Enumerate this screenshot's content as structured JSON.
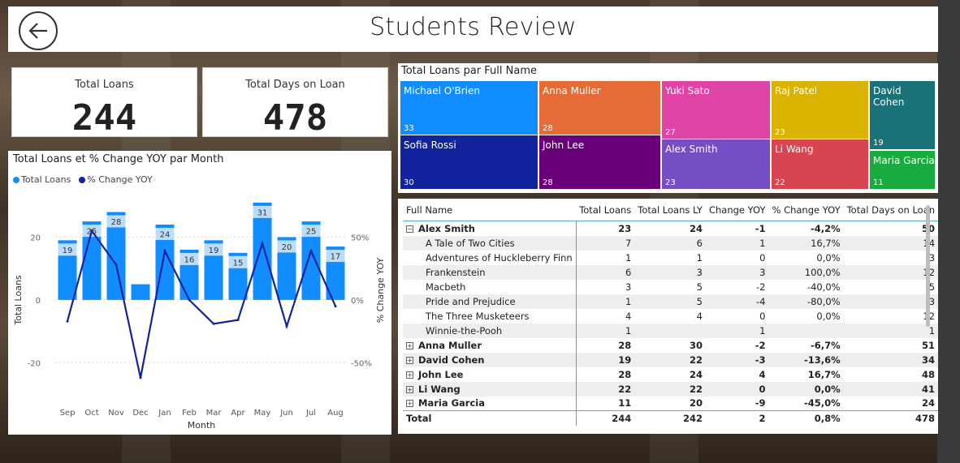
{
  "header": {
    "title": "Students Review"
  },
  "kpis": [
    {
      "label": "Total Loans",
      "value": "244"
    },
    {
      "label": "Total Days on Loan",
      "value": "478"
    }
  ],
  "combo": {
    "title": "Total Loans et % Change YOY par Month",
    "legend": [
      {
        "label": "Total Loans",
        "color": "#118DFF"
      },
      {
        "label": "% Change YOY",
        "color": "#12239E"
      }
    ],
    "xlabel": "Month",
    "ylabel_left": "Total Loans",
    "ylabel_right": "% Change YOY",
    "left_ticks": [
      "20",
      "0",
      "-20"
    ],
    "right_ticks": [
      "50%",
      "0%",
      "-50%"
    ]
  },
  "chart_data": {
    "type": "bar",
    "categories": [
      "Sep",
      "Oct",
      "Nov",
      "Dec",
      "Jan",
      "Feb",
      "Mar",
      "Apr",
      "May",
      "Jun",
      "Jul",
      "Aug"
    ],
    "series": [
      {
        "name": "Total Loans",
        "values": [
          19,
          25,
          28,
          5,
          24,
          16,
          19,
          15,
          31,
          20,
          25,
          17
        ],
        "labels": [
          "19",
          "25",
          "28",
          "",
          "24",
          "16",
          "19",
          "15",
          "31",
          "20",
          "25",
          "17"
        ]
      },
      {
        "name": "% Change YOY",
        "values": [
          -0.17,
          0.55,
          0.28,
          -0.62,
          0.39,
          0.0,
          -0.19,
          -0.16,
          0.45,
          -0.21,
          0.39,
          -0.05
        ]
      }
    ],
    "ylim": [
      -30,
      32
    ],
    "y2lim": [
      -0.75,
      0.8
    ],
    "colors": {
      "bar": "#118DFF",
      "bar_label_bg": "#BCDDF9",
      "line": "#12239E"
    }
  },
  "treemap": {
    "title": "Total Loans par Full Name",
    "tiles": [
      {
        "name": "Michael O'Brien",
        "value": "33",
        "color": "#118DFF"
      },
      {
        "name": "Sofia Rossi",
        "value": "30",
        "color": "#12239E"
      },
      {
        "name": "Anna Muller",
        "value": "28",
        "color": "#E66C37"
      },
      {
        "name": "John Lee",
        "value": "28",
        "color": "#6B007B"
      },
      {
        "name": "Yuki Sato",
        "value": "27",
        "color": "#E044A7"
      },
      {
        "name": "Alex Smith",
        "value": "23",
        "color": "#744EC2"
      },
      {
        "name": "Raj Patel",
        "value": "23",
        "color": "#D9B300"
      },
      {
        "name": "Li Wang",
        "value": "22",
        "color": "#D64550"
      },
      {
        "name": "David Cohen",
        "value": "19",
        "color": "#197278"
      },
      {
        "name": "Maria Garcia",
        "value": "11",
        "color": "#1AAB40"
      }
    ]
  },
  "table": {
    "headers": [
      "Full Name",
      "Total Loans",
      "Total Loans LY",
      "Change YOY",
      "% Change YOY",
      "Total Days on Loan"
    ],
    "rows": [
      {
        "type": "parent",
        "expander": "⊟",
        "cells": [
          "Alex Smith",
          "23",
          "24",
          "-1",
          "-4,2%",
          "50"
        ]
      },
      {
        "type": "child",
        "cells": [
          "A Tale of Two Cities",
          "7",
          "6",
          "1",
          "16,7%",
          "14"
        ]
      },
      {
        "type": "child",
        "cells": [
          "Adventures of Huckleberry Finn",
          "1",
          "1",
          "0",
          "0,0%",
          "3"
        ]
      },
      {
        "type": "child",
        "cells": [
          "Frankenstein",
          "6",
          "3",
          "3",
          "100,0%",
          "12"
        ]
      },
      {
        "type": "child",
        "cells": [
          "Macbeth",
          "3",
          "5",
          "-2",
          "-40,0%",
          "5"
        ]
      },
      {
        "type": "child",
        "cells": [
          "Pride and Prejudice",
          "1",
          "5",
          "-4",
          "-80,0%",
          "3"
        ]
      },
      {
        "type": "child",
        "cells": [
          "The Three Musketeers",
          "4",
          "4",
          "0",
          "0,0%",
          "12"
        ]
      },
      {
        "type": "child",
        "cells": [
          "Winnie-the-Pooh",
          "1",
          "",
          "1",
          "",
          "1"
        ]
      },
      {
        "type": "parent",
        "expander": "⊞",
        "cells": [
          "Anna Muller",
          "28",
          "30",
          "-2",
          "-6,7%",
          "51"
        ]
      },
      {
        "type": "parent",
        "expander": "⊞",
        "cells": [
          "David Cohen",
          "19",
          "22",
          "-3",
          "-13,6%",
          "34"
        ]
      },
      {
        "type": "parent",
        "expander": "⊞",
        "cells": [
          "John Lee",
          "28",
          "24",
          "4",
          "16,7%",
          "48"
        ]
      },
      {
        "type": "parent",
        "expander": "⊞",
        "cells": [
          "Li Wang",
          "22",
          "22",
          "0",
          "0,0%",
          "41"
        ]
      },
      {
        "type": "parent",
        "expander": "⊞",
        "cells": [
          "Maria Garcia",
          "11",
          "20",
          "-9",
          "-45,0%",
          "24"
        ]
      },
      {
        "type": "total",
        "cells": [
          "Total",
          "244",
          "242",
          "2",
          "0,8%",
          "478"
        ]
      }
    ]
  }
}
